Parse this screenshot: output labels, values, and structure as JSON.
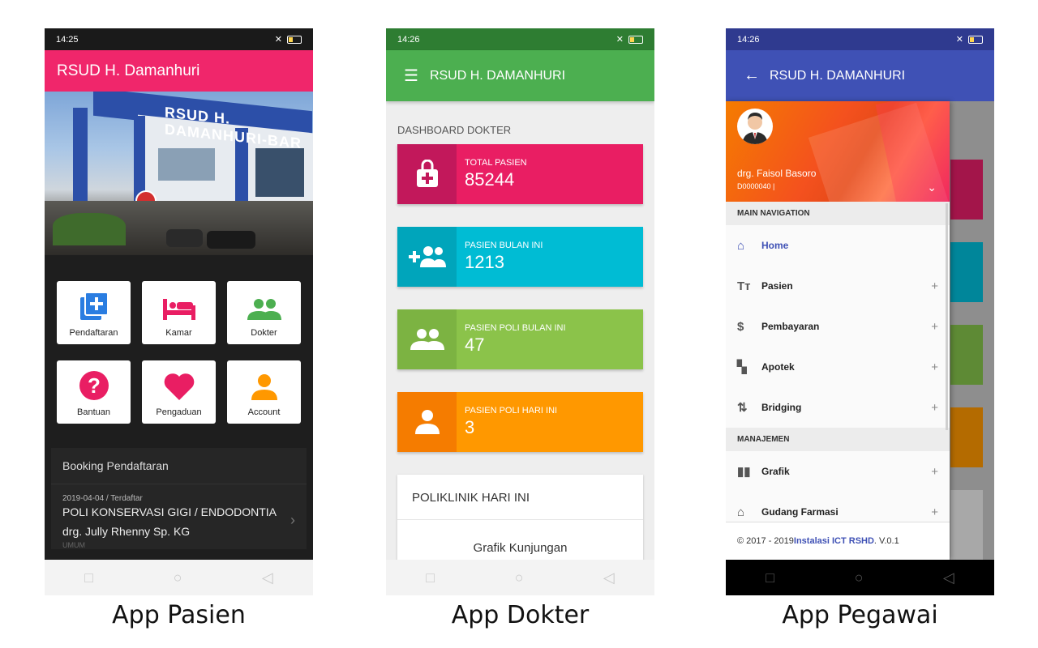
{
  "colors": {
    "pink": "#f0266b",
    "green": "#4caf50",
    "indigo": "#3f51b5",
    "cyan": "#00bcd4",
    "lime": "#8bc34a",
    "orange": "#ff9800"
  },
  "pasien": {
    "time": "14:25",
    "title": "RSUD H. Damanhuri",
    "menu": [
      {
        "label": "Pendaftaran",
        "icon": "add-box-icon"
      },
      {
        "label": "Kamar",
        "icon": "bed-icon"
      },
      {
        "label": "Dokter",
        "icon": "people-icon"
      },
      {
        "label": "Bantuan",
        "icon": "help-icon"
      },
      {
        "label": "Pengaduan",
        "icon": "heart-icon"
      },
      {
        "label": "Account",
        "icon": "person-icon"
      }
    ],
    "booking_title": "Booking Pendaftaran",
    "booking": {
      "date_status": "2019-04-04 / Terdaftar",
      "poli": "POLI KONSERVASI GIGI / ENDODONTIA",
      "doctor": "drg. Jully Rhenny Sp. KG",
      "category": "UMUM"
    },
    "caption": "App Pasien"
  },
  "dokter": {
    "time": "14:26",
    "title": "RSUD H. DAMANHURI",
    "dashboard_title": "DASHBOARD DOKTER",
    "cards": [
      {
        "label": "TOTAL PASIEN",
        "value": "85244",
        "icon": "hospital-bag-icon"
      },
      {
        "label": "PASIEN BULAN INI",
        "value": "1213",
        "icon": "group-add-icon"
      },
      {
        "label": "PASIEN POLI BULAN INI",
        "value": "47",
        "icon": "people-icon"
      },
      {
        "label": "PASIEN POLI HARI INI",
        "value": "3",
        "icon": "person-icon"
      }
    ],
    "poli_title": "POLIKLINIK HARI INI",
    "grafik_label": "Grafik Kunjungan",
    "caption": "App Dokter"
  },
  "pegawai": {
    "time": "14:26",
    "title": "RSUD H. DAMANHURI",
    "user_name": "drg. Faisol Basoro",
    "user_id": "D0000040 |",
    "main_nav": "MAIN NAVIGATION",
    "nav_items": [
      {
        "label": "Home",
        "icon": "home-icon"
      },
      {
        "label": "Pasien",
        "icon": "text-icon"
      },
      {
        "label": "Pembayaran",
        "icon": "dollar-icon"
      },
      {
        "label": "Apotek",
        "icon": "widgets-icon"
      },
      {
        "label": "Bridging",
        "icon": "swap-vert-icon"
      }
    ],
    "manajemen": "MANAJEMEN",
    "manajemen_items": [
      {
        "label": "Grafik",
        "icon": "barcode-icon"
      },
      {
        "label": "Gudang Farmasi",
        "icon": "bank-icon"
      }
    ],
    "footer_prefix": "© 2017 - 2019 ",
    "footer_link": "Instalasi ICT RSHD",
    "footer_suffix": ". V.0.1",
    "caption": "App Pegawai"
  }
}
